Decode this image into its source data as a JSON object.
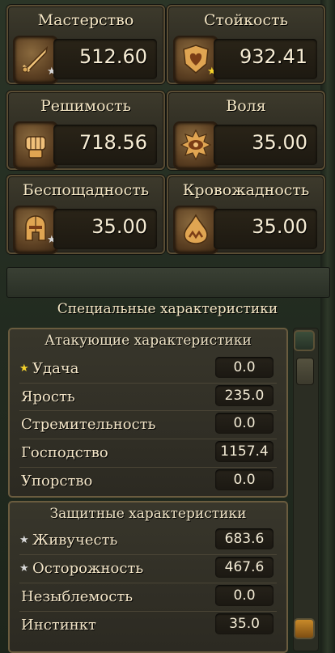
{
  "stats": [
    {
      "title": "Мастерство",
      "value": "512.60",
      "icon": "crossed-swords-icon",
      "star": "silver"
    },
    {
      "title": "Стойкость",
      "value": "932.41",
      "icon": "heart-shield-icon",
      "star": "gold"
    },
    {
      "title": "Решимость",
      "value": "718.56",
      "icon": "fist-icon",
      "star": ""
    },
    {
      "title": "Воля",
      "value": "35.00",
      "icon": "eye-sun-icon",
      "star": ""
    },
    {
      "title": "Беспощадность",
      "value": "35.00",
      "icon": "helmet-icon",
      "star": "silver"
    },
    {
      "title": "Кровожадность",
      "value": "35.00",
      "icon": "blood-drop-icon",
      "star": ""
    }
  ],
  "banner": "Специальные характеристики",
  "attack": {
    "header": "Атакующие характеристики",
    "rows": [
      {
        "label": "Удача",
        "value": "0.0",
        "star": "gold"
      },
      {
        "label": "Ярость",
        "value": "235.0",
        "star": ""
      },
      {
        "label": "Стремительность",
        "value": "0.0",
        "star": ""
      },
      {
        "label": "Господство",
        "value": "1157.4",
        "star": ""
      },
      {
        "label": "Упорство",
        "value": "0.0",
        "star": ""
      }
    ]
  },
  "defense": {
    "header": "Защитные характеристики",
    "rows": [
      {
        "label": "Живучесть",
        "value": "683.6",
        "star": "silver"
      },
      {
        "label": "Осторожность",
        "value": "467.6",
        "star": "silver"
      },
      {
        "label": "Незыблемость",
        "value": "0.0",
        "star": ""
      },
      {
        "label": "Инстинкт",
        "value": "35.0",
        "star": ""
      }
    ]
  },
  "colors": {
    "gold_star": "#f5d22b",
    "silver_star": "#d8d8d8",
    "text": "#f4e6c8"
  }
}
